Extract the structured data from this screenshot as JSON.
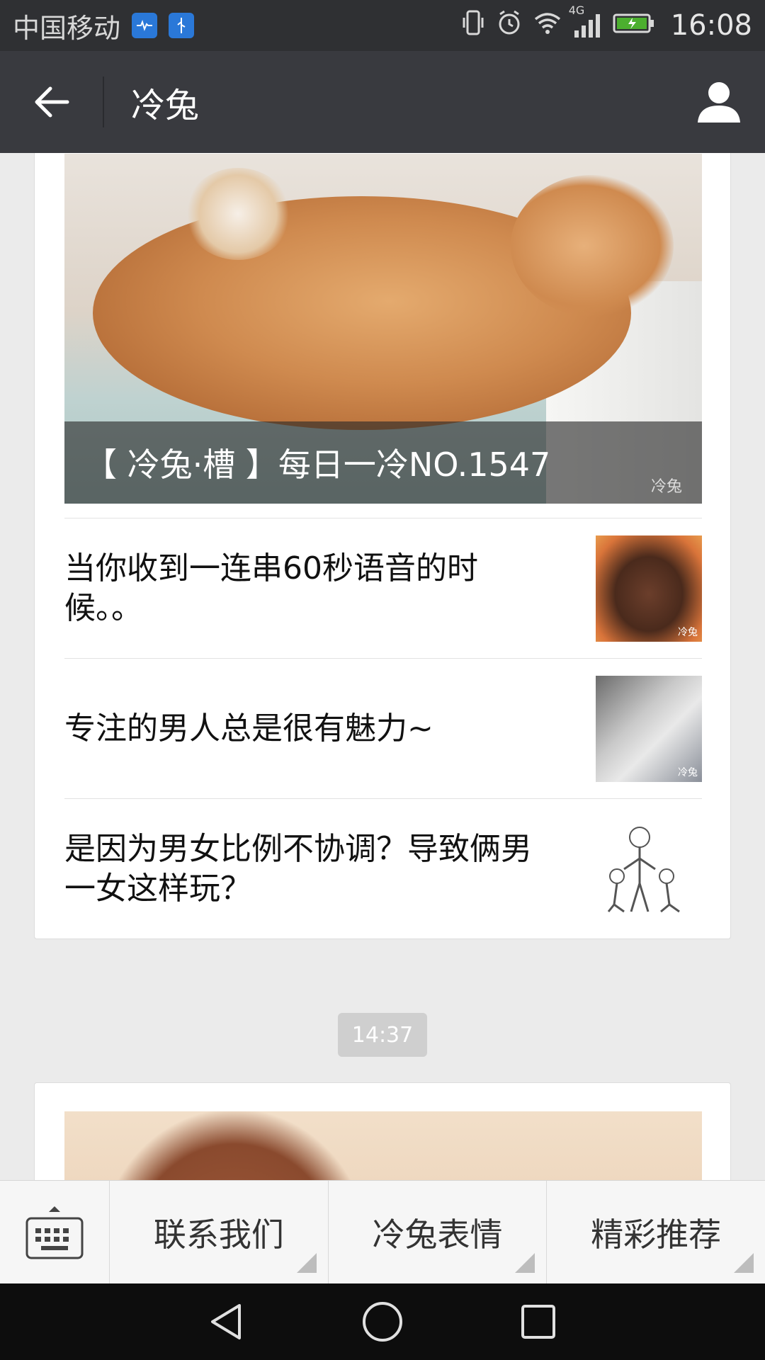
{
  "status_bar": {
    "carrier": "中国移动",
    "network": "4G",
    "time": "16:08",
    "icons": [
      "health-app-icon",
      "usb-icon",
      "vibrate-icon",
      "alarm-icon",
      "wifi-icon",
      "signal-icon",
      "battery-charging-icon"
    ]
  },
  "header": {
    "title": "冷兔",
    "back_icon": "back-arrow-icon",
    "profile_icon": "profile-icon"
  },
  "articles_card": {
    "cover": {
      "title": "【 冷兔·槽 】每日一冷NO.1547",
      "watermark": "冷兔"
    },
    "items": [
      {
        "title": "当你收到一连串60秒语音的时候。。",
        "thumb_label": "冷兔"
      },
      {
        "title": "专注的男人总是很有魅力~",
        "thumb_label": "冷兔"
      },
      {
        "title": "是因为男女比例不协调？导致俩男一女这样玩？",
        "thumb_label": ""
      }
    ]
  },
  "timestamp": "14:37",
  "bottom_menu": {
    "keyboard_icon": "keyboard-icon",
    "tabs": [
      "联系我们",
      "冷兔表情",
      "精彩推荐"
    ]
  },
  "nav_bar": {
    "icons": [
      "back-triangle-icon",
      "home-circle-icon",
      "recents-square-icon"
    ]
  },
  "colors": {
    "status_bar_bg": "#2f3033",
    "action_bar_bg": "#393a3f",
    "page_bg": "#ebebeb",
    "card_bg": "#ffffff",
    "time_chip_bg": "#cfcfcf",
    "nav_bar_bg": "#0d0d0d"
  }
}
